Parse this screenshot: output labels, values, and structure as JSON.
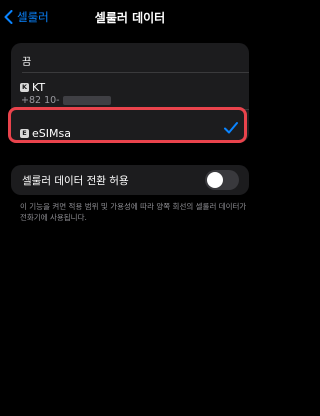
{
  "nav": {
    "back_label": "셀룰러",
    "title": "셀룰러 데이터"
  },
  "lines": {
    "off_label": "끔",
    "kt": {
      "badge": "K",
      "name": "KT",
      "number_prefix": "+82 10-"
    },
    "esim": {
      "badge": "E",
      "name": "eSIMsa",
      "selected": true
    }
  },
  "switching": {
    "label": "셀룰러 데이터 전환 허용",
    "enabled": false
  },
  "footnote": "이 기능을 켜면 적용 범위 및 가용성에 따라 양쪽 회선의 셀룰러 데이터가 전화기에 사용됩니다.",
  "colors": {
    "accent": "#0a84ff",
    "highlight": "#e9434c",
    "cell_background": "#1c1c1e"
  }
}
